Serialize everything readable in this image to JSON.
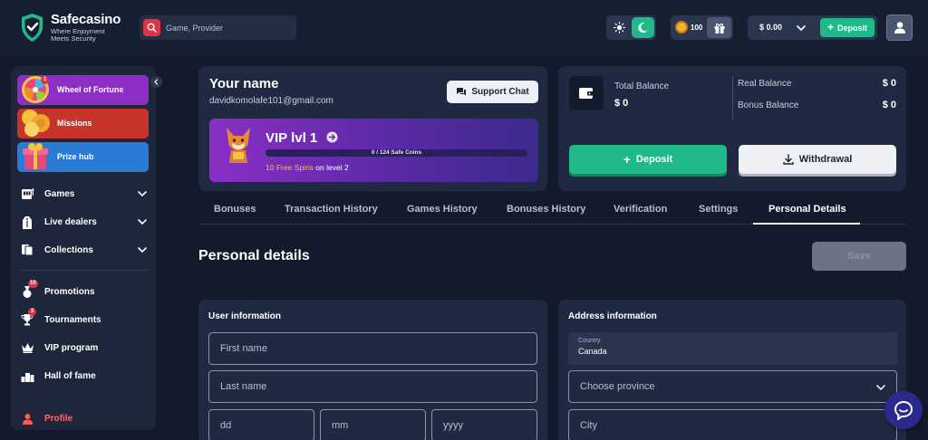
{
  "brand": {
    "name": "Safecasino",
    "tagline_line1": "Where Enjoyment",
    "tagline_line2": "Meets Security"
  },
  "search": {
    "placeholder": "Game, Provider"
  },
  "header": {
    "coins": "100",
    "balance": "$ 0.00",
    "deposit_label": "Deposit"
  },
  "sidebar": {
    "promos": [
      {
        "label": "Wheel of Fortune",
        "badge": "1",
        "color": "#8d2fc4"
      },
      {
        "label": "Missions",
        "color": "#c8342a"
      },
      {
        "label": "Prize hub",
        "color": "#2b7bd6"
      }
    ],
    "menu": [
      {
        "label": "Games"
      },
      {
        "label": "Live dealers"
      },
      {
        "label": "Collections"
      }
    ],
    "links": [
      {
        "label": "Promotions",
        "badge": "10"
      },
      {
        "label": "Tournaments",
        "badge": "3"
      },
      {
        "label": "VIP program"
      },
      {
        "label": "Hall of fame"
      },
      {
        "label": "Profile"
      }
    ]
  },
  "profile": {
    "title": "Your name",
    "email": "davidkomolafe101@gmail.com",
    "support_label": "Support Chat",
    "vip": {
      "title": "VIP lvl 1",
      "progress_text": "0 / 124 Safe Coins",
      "progress": 0,
      "spins_highlight": "10 Free Spins",
      "spins_rest": "on level 2"
    }
  },
  "balance": {
    "total_label": "Total Balance",
    "total_value": "$ 0",
    "real_label": "Real Balance",
    "real_value": "$ 0",
    "bonus_label": "Bonus Balance",
    "bonus_value": "$ 0",
    "deposit_label": "Deposit",
    "withdraw_label": "Withdrawal"
  },
  "tabs": [
    {
      "label": "Bonuses"
    },
    {
      "label": "Transaction History"
    },
    {
      "label": "Games History"
    },
    {
      "label": "Bonuses History"
    },
    {
      "label": "Verification"
    },
    {
      "label": "Settings"
    },
    {
      "label": "Personal Details",
      "active": true
    }
  ],
  "personal": {
    "title": "Personal details",
    "save_label": "Save",
    "user_info": {
      "title": "User information",
      "first_name_ph": "First name",
      "last_name_ph": "Last name",
      "dd_ph": "dd",
      "mm_ph": "mm",
      "yyyy_ph": "yyyy"
    },
    "address_info": {
      "title": "Address information",
      "country_label": "Country",
      "country_value": "Canada",
      "province_ph": "Choose province",
      "city_ph": "City"
    }
  },
  "colors": {
    "accent": "#1fb98a",
    "alert": "#e0334a",
    "vip": "#8a2fc6"
  }
}
